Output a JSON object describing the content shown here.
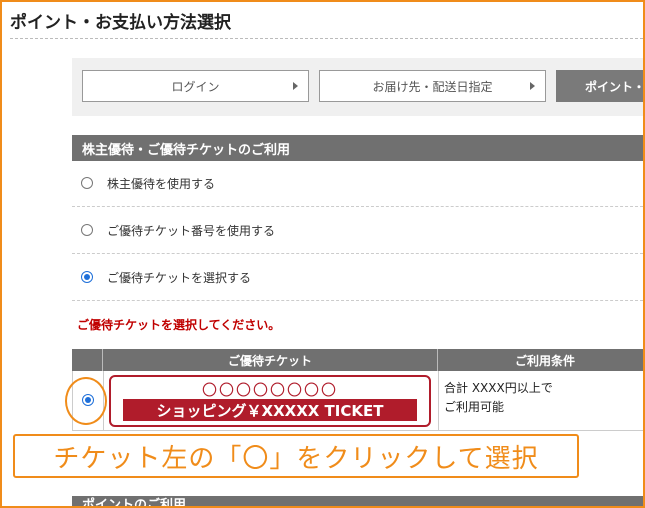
{
  "page": {
    "title": "ポイント・お支払い方法選択"
  },
  "steps": [
    {
      "label": "ログイン"
    },
    {
      "label": "お届け先・配送日指定"
    },
    {
      "label": "ポイント・"
    }
  ],
  "ticket_section": {
    "heading": "株主優待・ご優待チケットのご利用",
    "options": [
      {
        "label": "株主優待を使用する",
        "checked": false
      },
      {
        "label": "ご優待チケット番号を使用する",
        "checked": false
      },
      {
        "label": "ご優待チケットを選択する",
        "checked": true
      }
    ],
    "notice": "ご優待チケットを選択してください。"
  },
  "ticket_table": {
    "headers": {
      "ticket": "ご優待チケット",
      "conditions": "ご利用条件"
    },
    "rows": [
      {
        "selected": true,
        "ticket_code": "〇〇〇〇〇〇〇〇",
        "ticket_name": "ショッピング￥XXXXX TICKET",
        "condition_line1": "合計 XXXX円以上で",
        "condition_line2": "ご利用可能"
      }
    ]
  },
  "callout": {
    "text": "チケット左の「〇」をクリックして選択"
  },
  "point_section": {
    "heading": "ポイントのご利用"
  },
  "colors": {
    "accent_orange": "#f08c1a",
    "header_gray": "#707070",
    "ticket_red": "#b01c2b",
    "notice_red": "#c00000",
    "radio_blue": "#1e6fd9"
  }
}
